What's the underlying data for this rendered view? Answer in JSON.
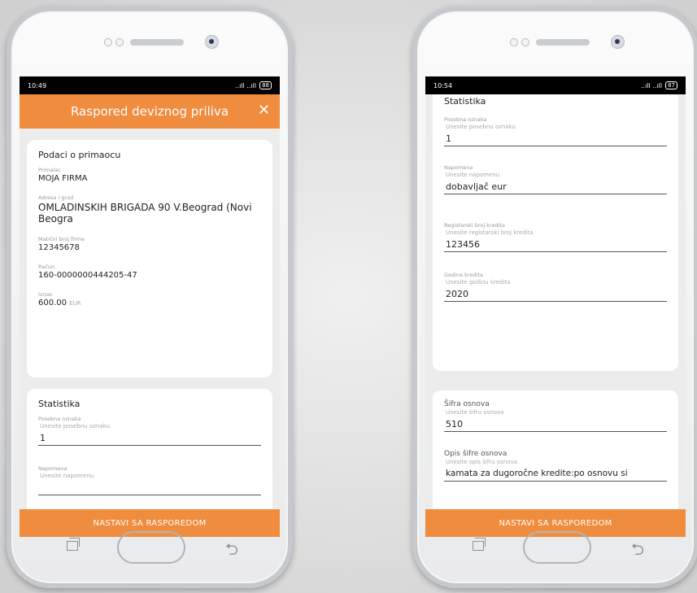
{
  "left": {
    "status": {
      "time": "10:49",
      "signal": "..ıll ..ıll",
      "battery": "88"
    },
    "appbar": {
      "title": "Raspored deviznog priliva",
      "close": "✕"
    },
    "recipient": {
      "title": "Podaci o primaocu",
      "fields": [
        {
          "label": "Primalac",
          "value": "MOJA FIRMA"
        },
        {
          "label": "Adresa i grad",
          "value": "OMLADINSKIH BRIGADA 90 V.Beograd (Novi Beogra"
        },
        {
          "label": "Matični broj firme",
          "value": "12345678"
        },
        {
          "label": "Račun",
          "value": "160-0000000444205-47"
        },
        {
          "label": "Iznos",
          "value": "600.00",
          "currency": "EUR"
        }
      ]
    },
    "stats": {
      "title": "Statistika",
      "fields": [
        {
          "label": "Posebna oznaka",
          "placeholder": "Unesite posebnu oznaku",
          "value": "1"
        },
        {
          "label": "Napomena",
          "placeholder": "Unesite napomenu",
          "value": ""
        }
      ]
    },
    "button": "NASTAVI SA RASPOREDOM"
  },
  "right": {
    "status": {
      "time": "10:54",
      "signal": "..ıll ..ıll",
      "battery": "87"
    },
    "stats_title": "Statistika",
    "fields": [
      {
        "label": "Posebna oznaka",
        "placeholder": "Unesite posebnu oznaku",
        "value": "1"
      },
      {
        "label": "Napomena",
        "placeholder": "Unesite napomenu",
        "value": "dobavljač eur"
      },
      {
        "label": "Registarski broj kredita",
        "placeholder": "Unesite registarski broj kredita",
        "value": "123456"
      },
      {
        "label": "Godina kredita",
        "placeholder": "Unesite godinu kredita",
        "value": "2020"
      }
    ],
    "basis": [
      {
        "label": "Šifra osnova",
        "placeholder": "Unesite šifru osnova",
        "value": "510"
      },
      {
        "label": "Opis šifre osnova",
        "placeholder": "Unesite opis šifru osnova",
        "value": "kamata za dugoročne kredite:po osnovu si"
      }
    ],
    "button": "NASTAVI SA RASPOREDOM"
  }
}
